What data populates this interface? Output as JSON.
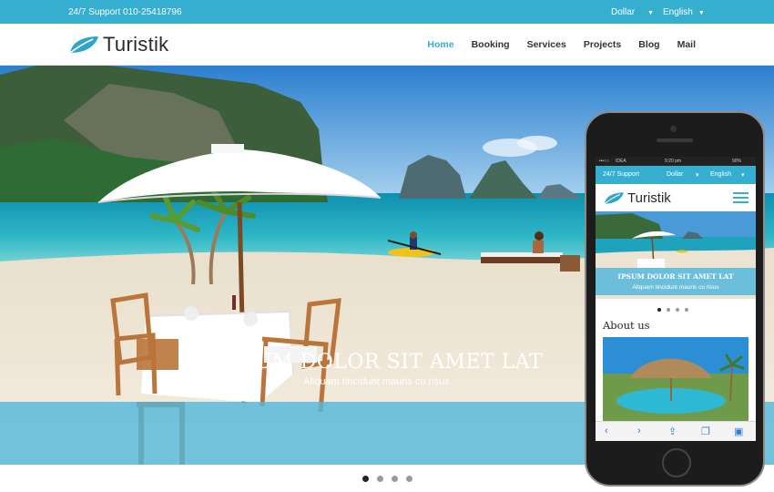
{
  "topbar": {
    "support": "24/7 Support 010-25418796",
    "currency": "Dollar",
    "language": "English"
  },
  "header": {
    "logo": "Turistik",
    "nav": [
      "Home",
      "Booking",
      "Services",
      "Projects",
      "Blog",
      "Mail"
    ],
    "active_nav": "Home"
  },
  "hero": {
    "title": "IPSUM DOLOR SIT AMET LAT",
    "subtitle": "Allquam tincidunt mauris cu risus",
    "slides": 4,
    "active_slide": 1
  },
  "mobile": {
    "status": {
      "carrier": "IDEA",
      "time": "9:20 pm",
      "battery": "90%"
    },
    "topbar": {
      "support": "24/7 Support",
      "currency": "Dollar",
      "language": "English"
    },
    "logo": "Turistik",
    "hero": {
      "title": "IPSUM DOLOR SIT AMET LAT",
      "subtitle": "Allquam tincidunt mauris cu risus"
    },
    "slides": 4,
    "about_title": "About us"
  },
  "colors": {
    "accent": "#36aed0",
    "band": "#56b8dc",
    "text": "#2a2a2a"
  },
  "icons": [
    "leaf-logo-icon",
    "caret-down-icon",
    "hamburger-icon",
    "back-icon",
    "forward-icon",
    "share-icon",
    "bookmarks-icon",
    "tabs-icon"
  ]
}
